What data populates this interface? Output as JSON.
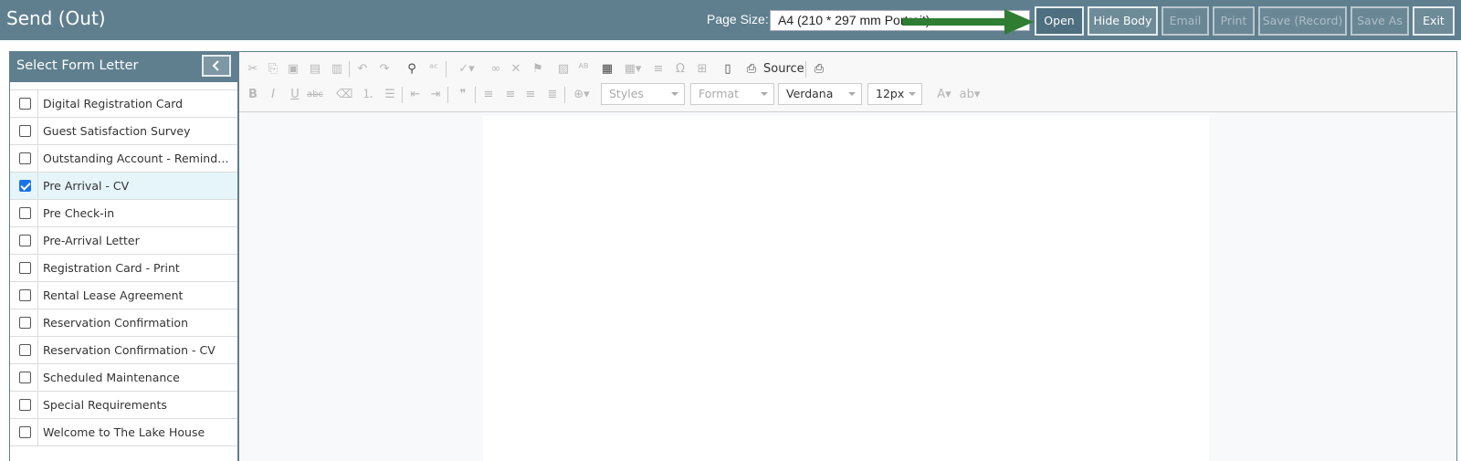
{
  "header": {
    "title": "Send (Out)",
    "page_size_label": "Page Size:",
    "page_size_value": "A4 (210 * 297 mm Portrait)",
    "buttons": {
      "open": "Open",
      "hide_body": "Hide Body",
      "email": "Email",
      "print": "Print",
      "save_record": "Save (Record)",
      "save_as": "Save As",
      "exit": "Exit"
    },
    "arrow_color": "#2e7d32"
  },
  "left_panel": {
    "title": "Select Form Letter",
    "collapse_icon": "chevron-left-icon",
    "items": [
      {
        "label": "Digital Registration Card",
        "checked": false
      },
      {
        "label": "Guest Satisfaction Survey",
        "checked": false
      },
      {
        "label": "Outstanding Account - Reminder N...",
        "checked": false
      },
      {
        "label": "Pre Arrival - CV",
        "checked": true
      },
      {
        "label": "Pre Check-in",
        "checked": false
      },
      {
        "label": "Pre-Arrival Letter",
        "checked": false
      },
      {
        "label": "Registration Card - Print",
        "checked": false
      },
      {
        "label": "Rental Lease Agreement",
        "checked": false
      },
      {
        "label": "Reservation Confirmation",
        "checked": false
      },
      {
        "label": "Reservation Confirmation - CV",
        "checked": false
      },
      {
        "label": "Scheduled Maintenance",
        "checked": false
      },
      {
        "label": "Special Requirements",
        "checked": false
      },
      {
        "label": "Welcome to The Lake House",
        "checked": false
      }
    ]
  },
  "editor": {
    "source_label": "Source",
    "styles_label": "Styles",
    "format_label": "Format",
    "font_value": "Verdana",
    "size_value": "12px"
  },
  "colors": {
    "header_bg": "#5f7f8e",
    "selected_row": "#e6f5fa"
  }
}
